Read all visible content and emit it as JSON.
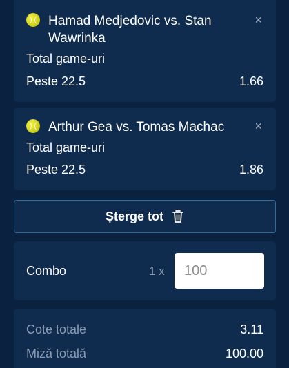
{
  "bets": [
    {
      "match": "Hamad Medjedovic vs. Stan Wawrinka",
      "market": "Total game-uri",
      "selection": "Peste 22.5",
      "odds": "1.66",
      "sport_icon": "tennis-ball-icon",
      "close_icon": "×"
    },
    {
      "match": "Arthur Gea vs. Tomas Machac",
      "market": "Total game-uri",
      "selection": "Peste 22.5",
      "odds": "1.86",
      "sport_icon": "tennis-ball-icon",
      "close_icon": "×"
    }
  ],
  "clear_all": {
    "label": "Șterge tot",
    "icon": "trash-icon"
  },
  "combo": {
    "label": "Combo",
    "multiplier": "1 x",
    "stake_placeholder": "100",
    "stake_value": ""
  },
  "totals": {
    "odds_label": "Cote totale",
    "odds_value": "3.11",
    "stake_label": "Miză totală",
    "stake_value": "100.00"
  },
  "colors": {
    "background": "#0b2140",
    "card": "#0f2b4d",
    "muted_text": "#8a9bb3",
    "button_border": "#2f6c9a",
    "ball": "#d8d82a"
  }
}
